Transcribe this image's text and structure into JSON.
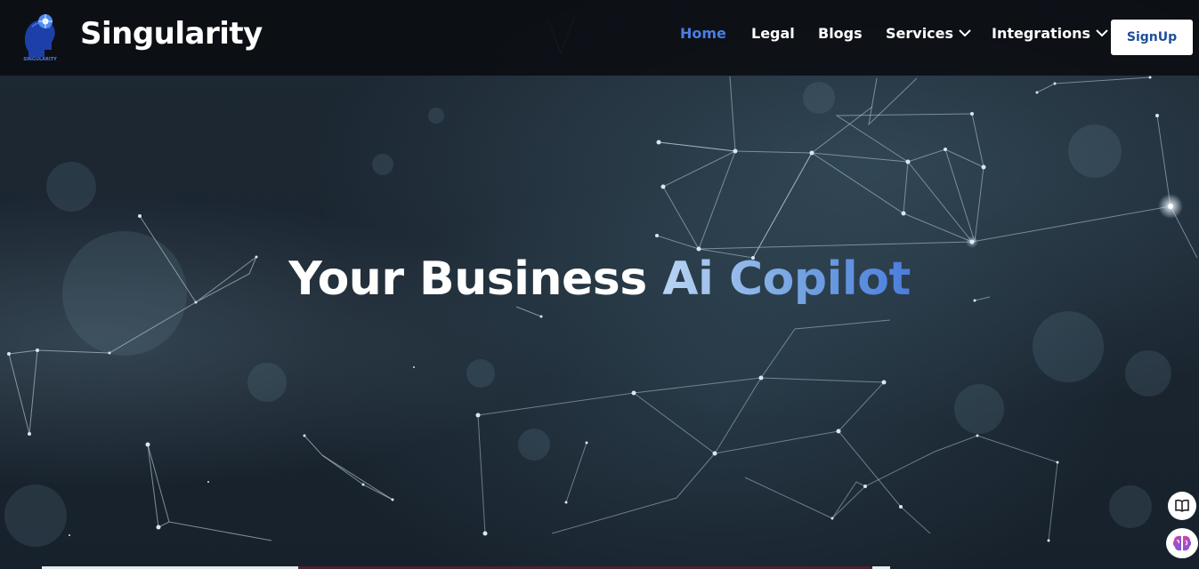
{
  "brand": {
    "name": "Singularity",
    "logo_caption": "SINGULARITY",
    "logo_icon": "ai-head-logo-icon"
  },
  "nav": {
    "items": [
      {
        "label": "Home",
        "active": true
      },
      {
        "label": "Legal"
      },
      {
        "label": "Blogs"
      },
      {
        "label": "Services",
        "has_dropdown": true
      },
      {
        "label": "Integrations",
        "has_dropdown": true
      }
    ],
    "signup_label": "SignUp"
  },
  "hero": {
    "headline_part1": "Your Business ",
    "headline_accent": "Ai Copilot"
  },
  "floating_buttons": [
    {
      "icon": "book-icon"
    },
    {
      "icon": "brain-icon"
    }
  ],
  "colors": {
    "accent": "#4a7de6",
    "topbar": "#080a0e",
    "hero_bg": "#1b2530"
  }
}
